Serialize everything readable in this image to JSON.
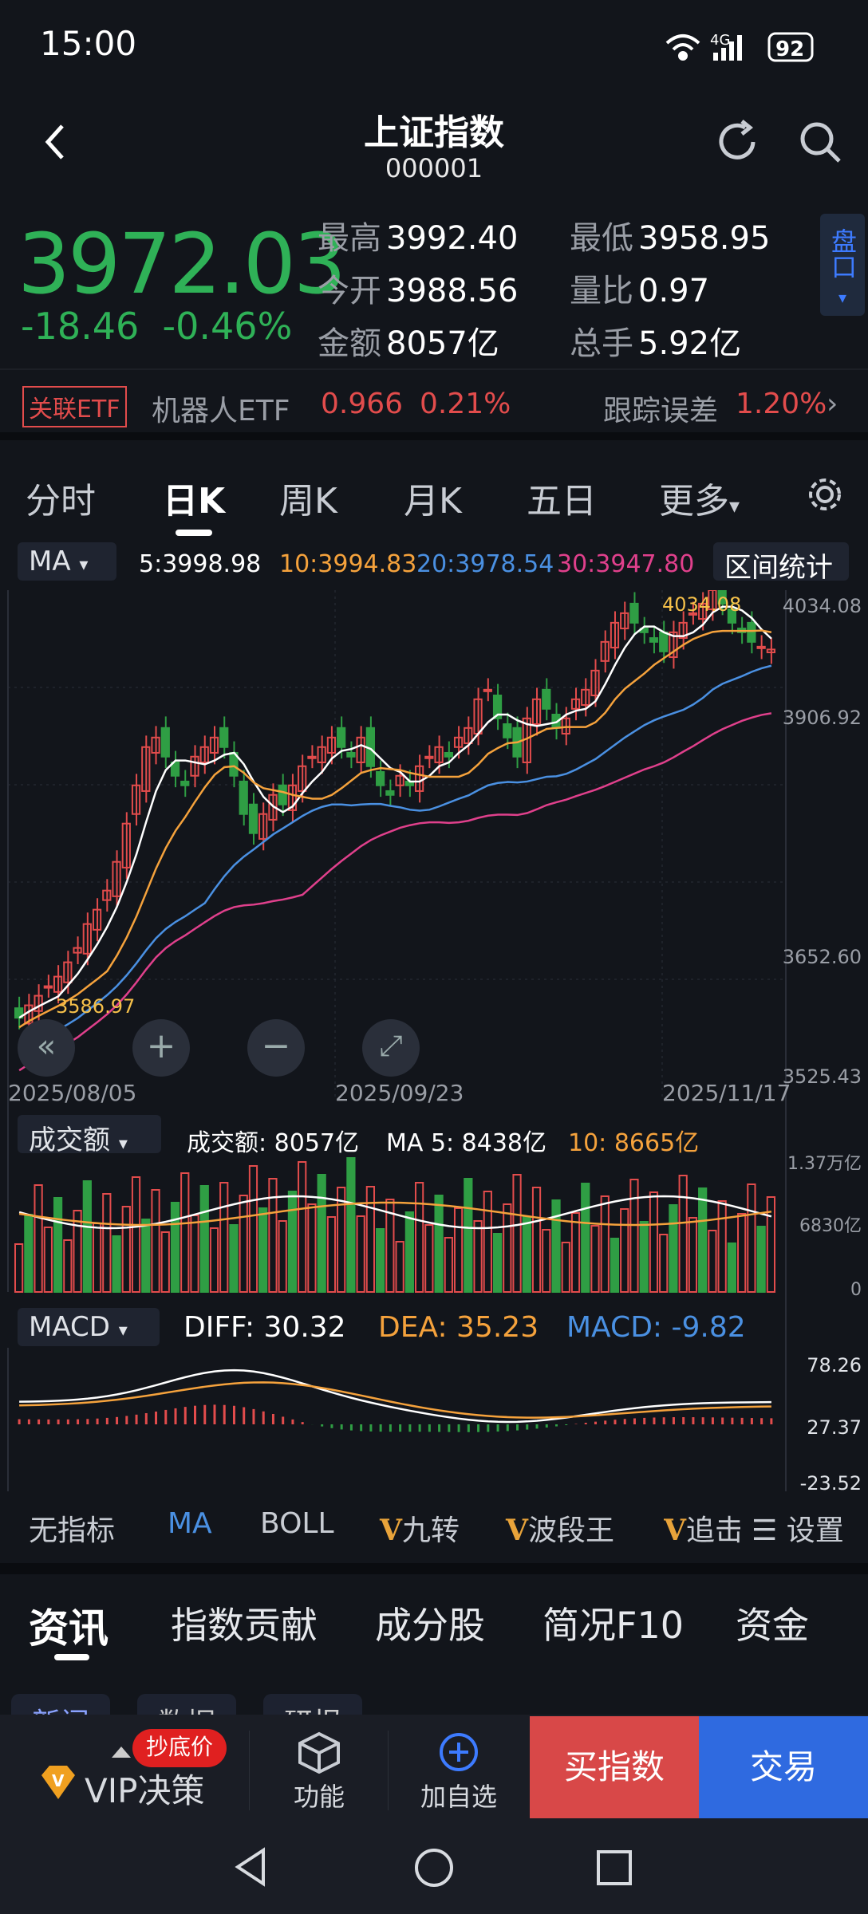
{
  "status": {
    "time": "15:00",
    "battery": "92",
    "signal": "4G"
  },
  "header": {
    "title": "上证指数",
    "code": "000001"
  },
  "quote": {
    "price": "3972.03",
    "change": "-18.46",
    "change_pct": "-0.46%",
    "high_label": "最高",
    "high": "3992.40",
    "low_label": "最低",
    "low": "3958.95",
    "open_label": "今开",
    "open": "3988.56",
    "ratio_label": "量比",
    "ratio": "0.97",
    "amount_label": "金额",
    "amount": "8057亿",
    "hands_label": "总手",
    "hands": "5.92亿",
    "pankou": "盘口"
  },
  "etf": {
    "tag": "关联ETF",
    "name": "机器人ETF",
    "price": "0.966",
    "pct": "0.21%",
    "track_label": "跟踪误差",
    "track": "1.20%"
  },
  "tabs": [
    "分时",
    "日K",
    "周K",
    "月K",
    "五日",
    "更多"
  ],
  "ma": {
    "selector": "MA",
    "ma5": "5:3998.98",
    "ma10": "10:3994.83",
    "ma20": "20:3978.54",
    "ma30": "30:3947.80",
    "range_btn": "区间统计"
  },
  "chart_data": [
    {
      "type": "candlestick",
      "title": "日K",
      "ylim": [
        3525.43,
        4034.08
      ],
      "y_ticks": [
        "4034.08",
        "3906.92",
        "3652.60",
        "3525.43"
      ],
      "x_ticks": [
        "2025/08/05",
        "2025/09/23",
        "2025/11/17"
      ],
      "annotations": [
        "4034.08",
        "3586.97"
      ],
      "series": [
        {
          "name": "MA5"
        },
        {
          "name": "MA10"
        },
        {
          "name": "MA20"
        },
        {
          "name": "MA30"
        }
      ]
    },
    {
      "type": "bar",
      "title": "成交额",
      "y_ticks": [
        "1.37万亿",
        "6830亿",
        "0"
      ]
    },
    {
      "type": "line",
      "title": "MACD",
      "y_ticks": [
        "78.26",
        "27.37",
        "-23.52"
      ]
    }
  ],
  "volume": {
    "selector": "成交额",
    "label": "成交额: 8057亿",
    "ma5": "MA 5: 8438亿",
    "ma10": "10: 8665亿"
  },
  "macd": {
    "selector": "MACD",
    "diff": "DIFF: 30.32",
    "dea": "DEA: 35.23",
    "macd": "MACD: -9.82"
  },
  "indicators": [
    "无指标",
    "MA",
    "BOLL",
    "九转",
    "波段王",
    "追击"
  ],
  "settings": "设置",
  "bottom_tabs": [
    "资讯",
    "指数贡献",
    "成分股",
    "简况F10",
    "资金"
  ],
  "sub_tabs": [
    "新闻",
    "数据",
    "研报"
  ],
  "actions": {
    "badge": "抄底价",
    "vip": "VIP决策",
    "func": "功能",
    "add": "加自选",
    "buy": "买指数",
    "trade": "交易"
  },
  "colors": {
    "up": "#e24c4c",
    "down": "#2f9e44",
    "ma5": "#ffffff",
    "ma10": "#f5a23c",
    "ma20": "#4a90e2",
    "ma30": "#e0408c"
  }
}
